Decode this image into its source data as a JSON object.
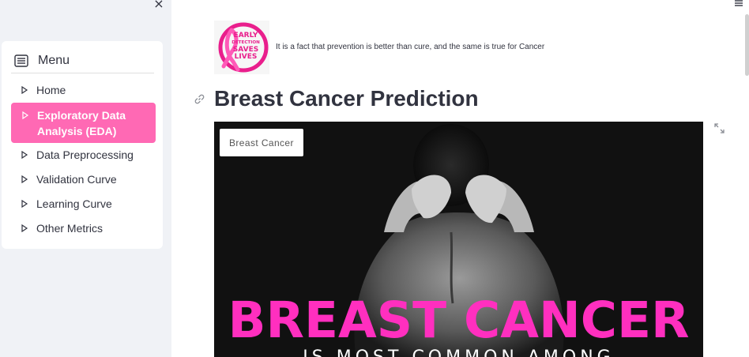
{
  "sidebar": {
    "close_glyph": "×",
    "menu_title": "Menu",
    "menu_icon": "menu-list-icon",
    "items": [
      {
        "label": "Home",
        "active": false
      },
      {
        "label": "Exploratory Data Analysis (EDA)",
        "active": true
      },
      {
        "label": "Data Preprocessing",
        "active": false
      },
      {
        "label": "Validation Curve",
        "active": false
      },
      {
        "label": "Learning Curve",
        "active": false
      },
      {
        "label": "Other Metrics",
        "active": false
      }
    ]
  },
  "main": {
    "logo_text": [
      "EARLY",
      "DETECTION",
      "SAVES",
      "LIVES"
    ],
    "tagline": "It is a fact that prevention is better than cure, and the same is true for Cancer",
    "title": "Breast Cancer Prediction",
    "hero": {
      "badge": "Breast Cancer",
      "headline": "BREAST CANCER",
      "subline": "IS MOST COMMON AMONG"
    }
  },
  "colors": {
    "accent": "#ff69b4",
    "sidebar_bg": "#f0f2f6",
    "headline_pink": "#ff2fbf",
    "text": "#31333f"
  }
}
